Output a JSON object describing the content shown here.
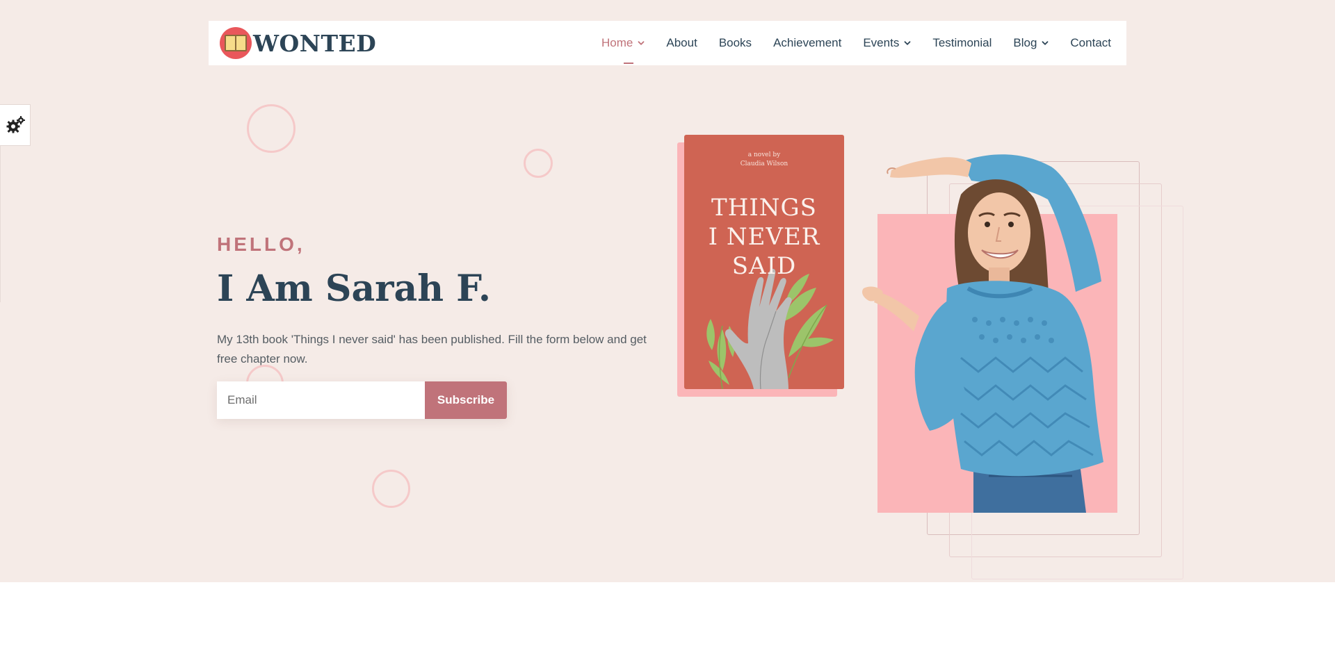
{
  "brand": {
    "name": "WONTED",
    "logo_icon": "open-book-icon"
  },
  "nav": {
    "items": [
      {
        "label": "Home",
        "active": true,
        "dropdown": true
      },
      {
        "label": "About",
        "active": false,
        "dropdown": false
      },
      {
        "label": "Books",
        "active": false,
        "dropdown": false
      },
      {
        "label": "Achievement",
        "active": false,
        "dropdown": false
      },
      {
        "label": "Events",
        "active": false,
        "dropdown": true
      },
      {
        "label": "Testimonial",
        "active": false,
        "dropdown": false
      },
      {
        "label": "Blog",
        "active": false,
        "dropdown": true
      },
      {
        "label": "Contact",
        "active": false,
        "dropdown": false
      }
    ]
  },
  "settings": {
    "icon": "gears-icon"
  },
  "hero": {
    "greeting": "HELLO,",
    "name": "I Am Sarah F.",
    "description": "My 13th book 'Things I never said' has been published. Fill the form below and get free chapter now.",
    "email_placeholder": "Email",
    "subscribe_label": "Subscribe"
  },
  "book": {
    "byline_1": "a novel by",
    "byline_2": "Claudia Wilson",
    "title_1": "THINGS",
    "title_2": "I NEVER",
    "title_3": "SAID"
  },
  "colors": {
    "accent": "#c0737a",
    "hero_bg": "#f5ebe7",
    "heading": "#2c4456",
    "book_cover": "#cf6453",
    "pink_block": "#fbb5b8",
    "sweater": "#5aa6cf"
  }
}
